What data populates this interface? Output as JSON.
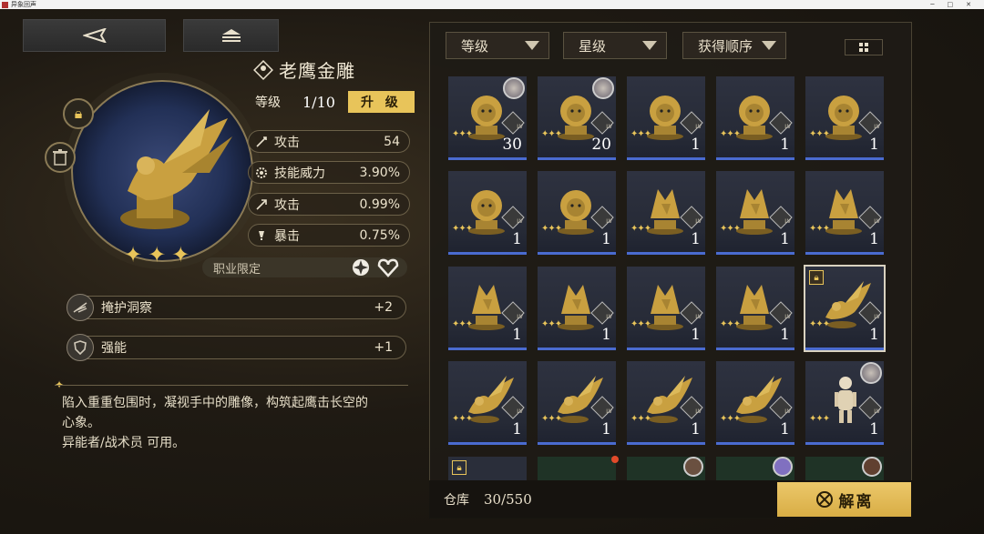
{
  "window": {
    "title": "异象回声"
  },
  "nav": {
    "back_label": "",
    "menu_label": ""
  },
  "item": {
    "name": "老鹰金雕",
    "level_label": "等级",
    "level_value": "1/10",
    "upgrade_label": "升 级",
    "stars": 3,
    "stats": [
      {
        "name": "攻击",
        "value": "54",
        "icon": "sword-icon"
      },
      {
        "name": "技能威力",
        "value": "3.90%",
        "icon": "gear-icon"
      },
      {
        "name": "攻击",
        "value": "0.99%",
        "icon": "arrow-icon"
      },
      {
        "name": "暴击",
        "value": "0.75%",
        "icon": "exclaim-icon"
      }
    ],
    "job_label": "职业限定",
    "skills": [
      {
        "name": "掩护洞察",
        "value": "+2",
        "icon": "feather-icon"
      },
      {
        "name": "强能",
        "value": "+1",
        "icon": "shield-icon"
      }
    ],
    "description": [
      "陷入重重包围时，凝视手中的雕像，构筑起鹰击长空的",
      "心象。",
      "异能者/战术员 可用。"
    ]
  },
  "inventory": {
    "filters": [
      "等级",
      "星级",
      "获得顺序"
    ],
    "stock_label": "仓库",
    "stock_value": "30/550",
    "release_label": "解离",
    "cards": [
      {
        "kind": "lion",
        "level": "30",
        "avatar": true
      },
      {
        "kind": "lion",
        "level": "20",
        "avatar": true
      },
      {
        "kind": "lion",
        "level": "1"
      },
      {
        "kind": "lion",
        "level": "1"
      },
      {
        "kind": "lion",
        "level": "1"
      },
      {
        "kind": "lion",
        "level": "1"
      },
      {
        "kind": "lion",
        "level": "1"
      },
      {
        "kind": "wolf",
        "level": "1"
      },
      {
        "kind": "wolf",
        "level": "1"
      },
      {
        "kind": "wolf",
        "level": "1"
      },
      {
        "kind": "wolf",
        "level": "1"
      },
      {
        "kind": "wolf",
        "level": "1"
      },
      {
        "kind": "wolf",
        "level": "1"
      },
      {
        "kind": "wolf",
        "level": "1"
      },
      {
        "kind": "eagle",
        "level": "1",
        "locked": true,
        "selected": true
      },
      {
        "kind": "eagle",
        "level": "1"
      },
      {
        "kind": "eagle",
        "level": "1"
      },
      {
        "kind": "eagle",
        "level": "1"
      },
      {
        "kind": "eagle",
        "level": "1"
      },
      {
        "kind": "doll",
        "level": "1",
        "avatar": true
      }
    ]
  },
  "colors": {
    "accent": "#e8c45a",
    "lv_bar": "#4a6bd0"
  }
}
